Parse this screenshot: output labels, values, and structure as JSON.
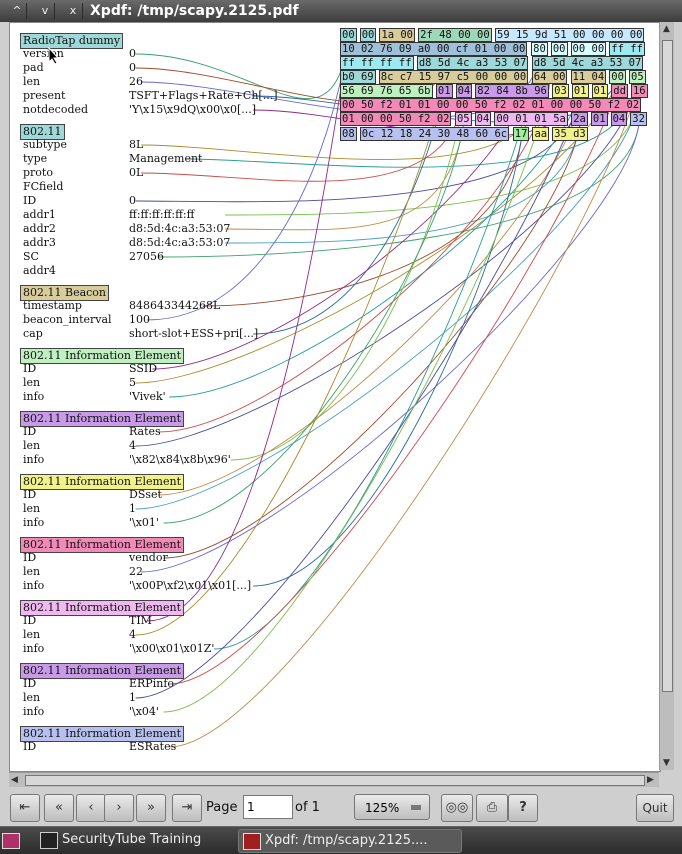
{
  "window": {
    "title": "Xpdf: /tmp/scapy.2125.pdf",
    "controls": [
      "^",
      "v",
      "x"
    ]
  },
  "layers": [
    {
      "name": "RadioTap dummy",
      "color": "#9ed8d8",
      "fields": [
        {
          "name": "version",
          "value": "0"
        },
        {
          "name": "pad",
          "value": "0"
        },
        {
          "name": "len",
          "value": "26"
        },
        {
          "name": "present",
          "value": "TSFT+Flags+Rate+Ch[...]"
        },
        {
          "name": "notdecoded",
          "value": "'Y\\x15\\x9dQ\\x00\\x0[...]"
        }
      ]
    },
    {
      "name": "802.11",
      "color": "#9ed8d8",
      "fields": [
        {
          "name": "subtype",
          "value": "8L"
        },
        {
          "name": "type",
          "value": "Management"
        },
        {
          "name": "proto",
          "value": "0L"
        },
        {
          "name": "FCfield",
          "value": ""
        },
        {
          "name": "ID",
          "value": "0"
        },
        {
          "name": "addr1",
          "value": "ff:ff:ff:ff:ff:ff"
        },
        {
          "name": "addr2",
          "value": "d8:5d:4c:a3:53:07"
        },
        {
          "name": "addr3",
          "value": "d8:5d:4c:a3:53:07"
        },
        {
          "name": "SC",
          "value": "27056"
        },
        {
          "name": "addr4",
          "value": ""
        }
      ]
    },
    {
      "name": "802.11 Beacon",
      "color": "#d8cc9a",
      "fields": [
        {
          "name": "timestamp",
          "value": "848643344268L"
        },
        {
          "name": "beacon_interval",
          "value": "100"
        },
        {
          "name": "cap",
          "value": "short-slot+ESS+pri[...]"
        }
      ]
    },
    {
      "name": "802.11 Information Element",
      "color": "#bff0bf",
      "fields": [
        {
          "name": "ID",
          "value": "SSID"
        },
        {
          "name": "len",
          "value": "5"
        },
        {
          "name": "info",
          "value": "'Vivek'"
        }
      ]
    },
    {
      "name": "802.11 Information Element",
      "color": "#c89ae8",
      "fields": [
        {
          "name": "ID",
          "value": "Rates"
        },
        {
          "name": "len",
          "value": "4"
        },
        {
          "name": "info",
          "value": "'\\x82\\x84\\x8b\\x96'"
        }
      ]
    },
    {
      "name": "802.11 Information Element",
      "color": "#f2f28a",
      "fields": [
        {
          "name": "ID",
          "value": "DSset"
        },
        {
          "name": "len",
          "value": "1"
        },
        {
          "name": "info",
          "value": "'\\x01'"
        }
      ]
    },
    {
      "name": "802.11 Information Element",
      "color": "#f28ab8",
      "fields": [
        {
          "name": "ID",
          "value": "vendor"
        },
        {
          "name": "len",
          "value": "22"
        },
        {
          "name": "info",
          "value": "'\\x00P\\xf2\\x01\\x01[...]"
        }
      ]
    },
    {
      "name": "802.11 Information Element",
      "color": "#f0b8f0",
      "fields": [
        {
          "name": "ID",
          "value": "TIM"
        },
        {
          "name": "len",
          "value": "4"
        },
        {
          "name": "info",
          "value": "'\\x00\\x01\\x01Z'"
        }
      ]
    },
    {
      "name": "802.11 Information Element",
      "color": "#c89ae8",
      "fields": [
        {
          "name": "ID",
          "value": "ERPinfo"
        },
        {
          "name": "len",
          "value": "1"
        },
        {
          "name": "info",
          "value": "'\\x04'"
        }
      ]
    },
    {
      "name": "802.11 Information Element",
      "color": "#b8c0f0",
      "fields": [
        {
          "name": "ID",
          "value": "ESRates"
        }
      ]
    }
  ],
  "hex_rows": [
    [
      {
        "t": "00",
        "c": "#9ed8d8"
      },
      {
        "t": "00",
        "c": "#9ed8d8"
      },
      {
        "t": "1a 00",
        "c": "#d8cc9a"
      },
      {
        "t": "2f 48 00 00",
        "c": "#9ed8b8"
      },
      {
        "t": "59 15 9d 51 00 00 00 00",
        "c": "#c8e8ff"
      }
    ],
    [
      {
        "t": "10 02 76 09 a0 00 cf 01 00 00",
        "c": "#9ec0d8"
      },
      {
        "t": "80",
        "c": "#d8ffff"
      },
      {
        "t": "00",
        "c": "#d8ffff"
      },
      {
        "t": "00 00",
        "c": "#d8ffff"
      },
      {
        "t": "ff ff",
        "c": "#9ee8f0"
      }
    ],
    [
      {
        "t": "ff ff ff ff",
        "c": "#9ee8f0"
      },
      {
        "t": "d8 5d 4c a3 53 07",
        "c": "#9ed8d8"
      },
      {
        "t": "d8 5d 4c a3 53 07",
        "c": "#9ed8d8"
      }
    ],
    [
      {
        "t": "b0 69",
        "c": "#9ed8d8"
      },
      {
        "t": "8c c7 15 97 c5 00 00 00",
        "c": "#d8cc9a"
      },
      {
        "t": "64 00",
        "c": "#d8cc9a"
      },
      {
        "t": "11 04",
        "c": "#d8cc9a"
      },
      {
        "t": "00",
        "c": "#bff0bf"
      },
      {
        "t": "05",
        "c": "#bff0bf"
      }
    ],
    [
      {
        "t": "56 69 76 65 6b",
        "c": "#bff0bf"
      },
      {
        "t": "01",
        "c": "#c89ae8"
      },
      {
        "t": "04",
        "c": "#c89ae8"
      },
      {
        "t": "82 84 8b 96",
        "c": "#c89ae8"
      },
      {
        "t": "03",
        "c": "#f2f28a"
      },
      {
        "t": "01",
        "c": "#f2f28a"
      },
      {
        "t": "01",
        "c": "#f2f28a"
      },
      {
        "t": "dd",
        "c": "#f28ab8"
      },
      {
        "t": "16",
        "c": "#f28ab8"
      }
    ],
    [
      {
        "t": "00 50 f2 01 01 00 00 50 f2 02 01 00 00 50 f2 02",
        "c": "#f28ab8"
      }
    ],
    [
      {
        "t": "01 00 00 50 f2 02",
        "c": "#f28ab8"
      },
      {
        "t": "05",
        "c": "#f0b8f0"
      },
      {
        "t": "04",
        "c": "#f0b8f0"
      },
      {
        "t": "00 01 01 5a",
        "c": "#f0b8f0"
      },
      {
        "t": "2a",
        "c": "#c89ae8"
      },
      {
        "t": "01",
        "c": "#c89ae8"
      },
      {
        "t": "04",
        "c": "#c89ae8"
      },
      {
        "t": "32",
        "c": "#b8c0f0"
      }
    ],
    [
      {
        "t": "08",
        "c": "#b8c0f0"
      },
      {
        "t": "0c 12 18 24 30 48 60 6c",
        "c": "#b8c0f0"
      },
      {
        "t": "17",
        "c": "#9ef09e"
      },
      {
        "t": "aa",
        "c": "#f2f28a"
      },
      {
        "t": "35 d3",
        "c": "#f2f28a"
      }
    ]
  ],
  "toolbar": {
    "page_label": "Page",
    "page_value": "1",
    "page_total": "of 1",
    "zoom": "125%",
    "quit_label": "Quit"
  },
  "taskbar": {
    "items": [
      "SecurityTube Training",
      "Xpdf: /tmp/scapy.2125...."
    ]
  },
  "colors": {
    "link_colors": [
      "#3aa06a",
      "#9a4a2a",
      "#6a6acc",
      "#2a6aa0",
      "#8a2a8a",
      "#aa8a2a",
      "#2a9a9a",
      "#cc4a4a",
      "#4a4a9a",
      "#7ac04a",
      "#c08a4a",
      "#4aa0c0"
    ]
  }
}
